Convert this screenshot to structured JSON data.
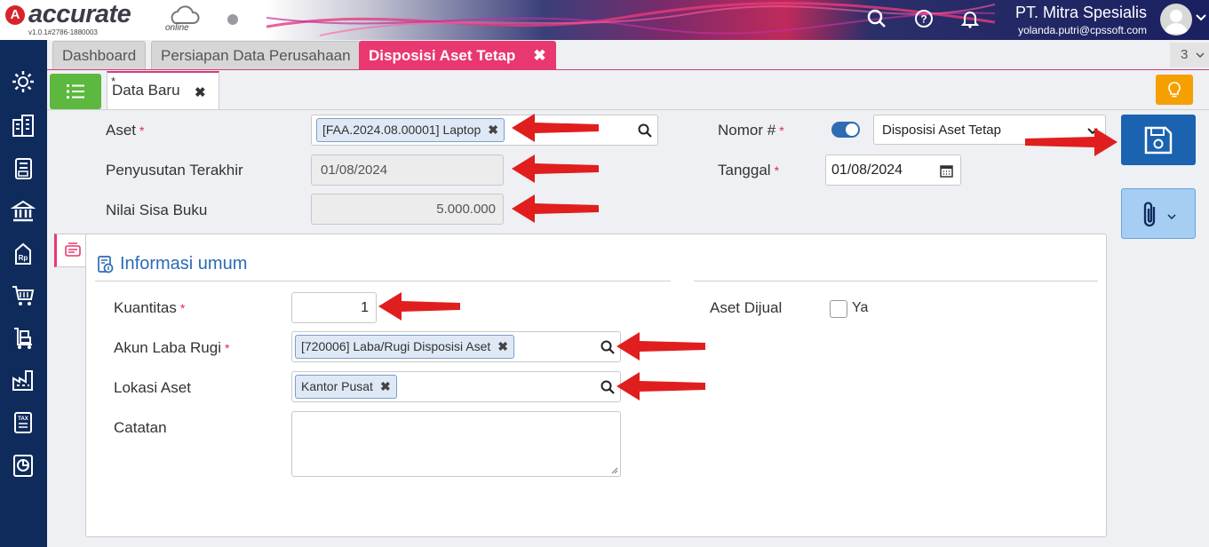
{
  "app": {
    "logo_text": "accurate",
    "logo_sub": "online",
    "version": "v1.0.1#2786-1880003",
    "company": "PT. Mitra Spesialis",
    "user_email": "yolanda.putri@cpssoft.com"
  },
  "tabs": {
    "items": [
      {
        "label": "Dashboard"
      },
      {
        "label": "Persiapan Data Perusahaan"
      },
      {
        "label": "Disposisi Aset Tetap",
        "close": "✖"
      }
    ],
    "count": "3"
  },
  "subtab": {
    "star": "*",
    "label": "Data Baru",
    "close": "✖"
  },
  "form": {
    "aset_label": "Aset",
    "aset_value": "[FAA.2024.08.00001] Laptop",
    "penyusutan_label": "Penyusutan Terakhir",
    "penyusutan_value": "01/08/2024",
    "nilai_label": "Nilai Sisa Buku",
    "nilai_value": "5.000.000",
    "nomor_label": "Nomor #",
    "nomor_value": "Disposisi Aset Tetap",
    "tanggal_label": "Tanggal",
    "tanggal_value": "01/08/2024",
    "required_mark": "*",
    "chip_remove": "✖"
  },
  "section": {
    "title": "Informasi umum",
    "kuantitas_label": "Kuantitas",
    "kuantitas_value": "1",
    "akun_label": "Akun Laba Rugi",
    "akun_value": "[720006] Laba/Rugi Disposisi Aset",
    "lokasi_label": "Lokasi Aset",
    "lokasi_value": "Kantor Pusat",
    "catatan_label": "Catatan",
    "catatan_value": "",
    "aset_dijual_label": "Aset Dijual",
    "aset_dijual_option": "Ya"
  },
  "colors": {
    "accent_pink": "#e8386f",
    "sidebar": "#0f2b5c",
    "save_blue": "#1b62b0",
    "list_green": "#5cb83e",
    "arrow_red": "#e01e1e"
  }
}
